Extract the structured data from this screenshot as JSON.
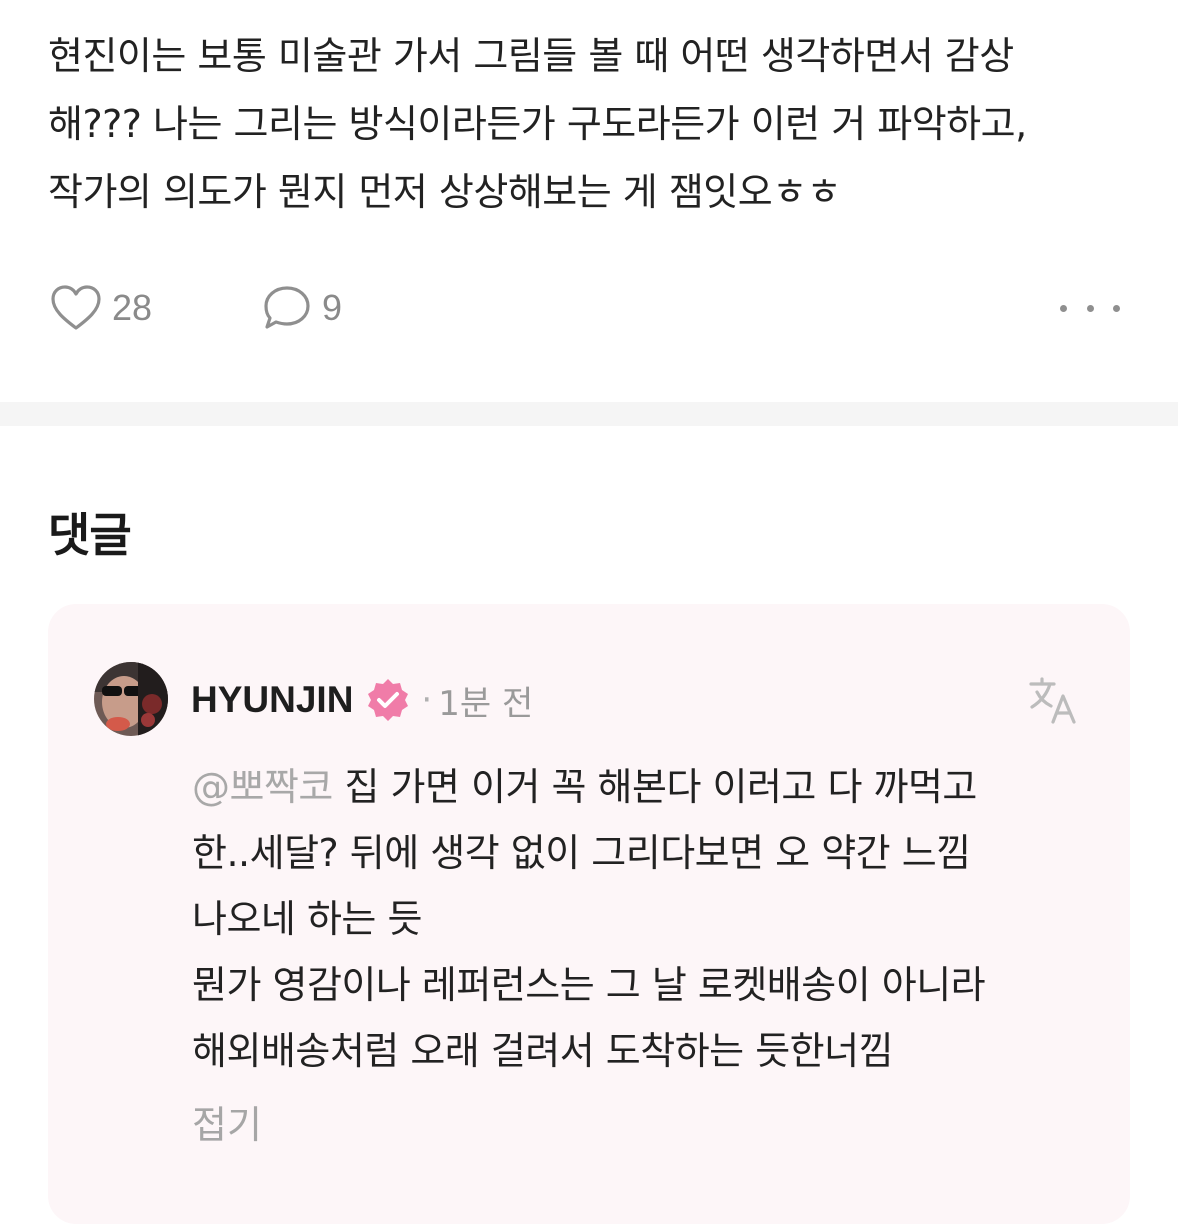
{
  "post": {
    "lines": [
      "현진이는 보통 미술관 가서 그림들 볼 때 어떤 생각하면서 감상",
      "해??? 나는 그리는 방식이라든가 구도라든가 이런 거 파악하고,",
      "작가의 의도가 뭔지 먼저 상상해보는 게 잼잇오ㅎㅎ"
    ],
    "likes": "28",
    "comments": "9"
  },
  "icons": {
    "like": "heart-outline-icon",
    "comment": "speech-bubble-icon",
    "more": "more-horizontal-icon",
    "verified": "verified-badge-icon",
    "translate": "translate-icon"
  },
  "comments_section": {
    "title": "댓글",
    "items": [
      {
        "author": "HYUNJIN",
        "separator": "·",
        "time": "1분 전",
        "mention": "@뽀짝코",
        "first_line_rest": " 집 가면 이거 꼭 해본다 이러고 다 까먹고",
        "lines": [
          "한..세달? 뒤에 생각 없이 그리다보면 오 약간 느낌",
          "나오네 하는 듯",
          "뭔가 영감이나 레퍼런스는 그 날 로켓배송이 아니라",
          "해외배송처럼 오래 걸려서 도착하는 듯한너낌"
        ],
        "collapse_label": "접기"
      }
    ]
  },
  "colors": {
    "card_background": "#fdf6f8",
    "verified_badge": "#f07ca8",
    "muted_text": "#9a9a9a",
    "divider": "#f5f5f5"
  }
}
